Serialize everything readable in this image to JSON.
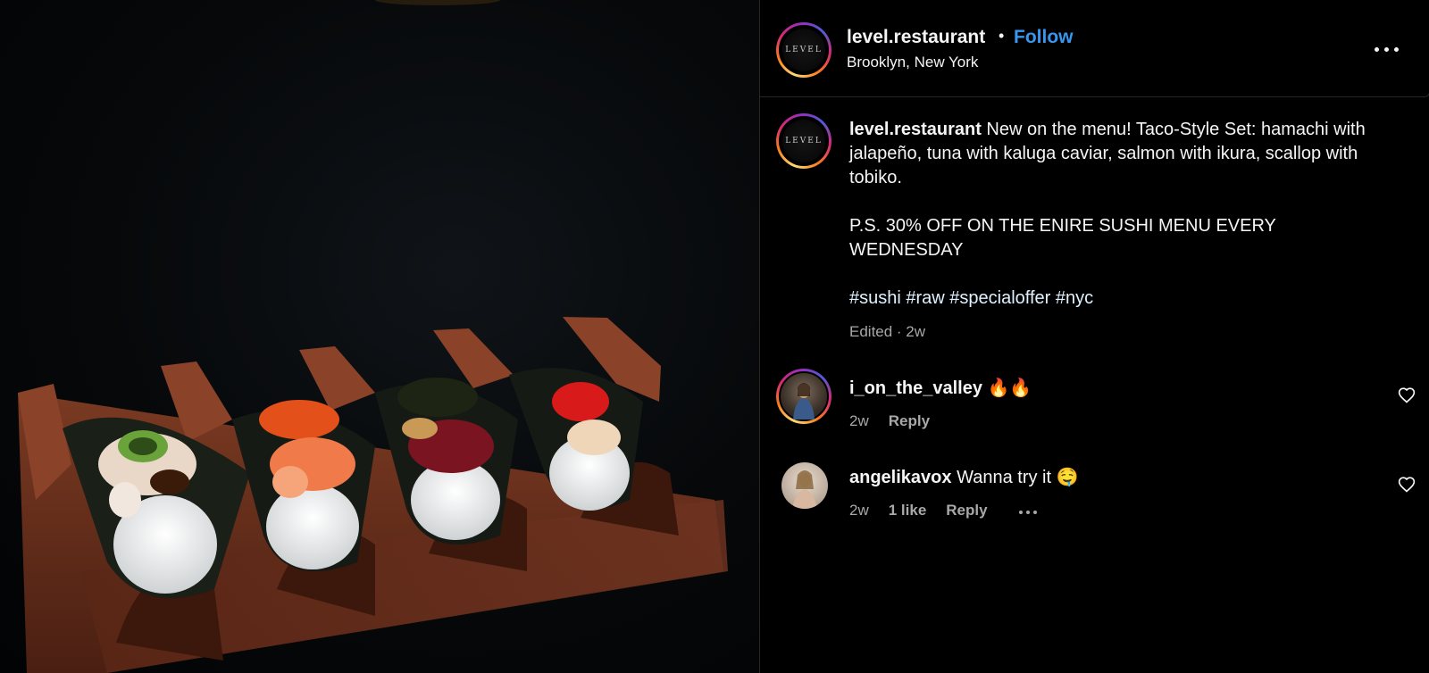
{
  "post": {
    "username": "level.restaurant",
    "follow_label": "Follow",
    "location": "Brooklyn, New York",
    "separator": "•"
  },
  "caption": {
    "username": "level.restaurant",
    "text": "New on the menu! Taco-Style Set: hamachi with jalapeño, tuna with kaluga caviar, salmon with ikura, scallop with tobiko.",
    "promo": "P.S. 30% OFF ON THE ENIRE SUSHI MENU EVERY WEDNESDAY",
    "hashtags": [
      "#sushi",
      "#raw",
      "#specialoffer",
      "#nyc"
    ],
    "meta": "Edited · 2w"
  },
  "comments": [
    {
      "username": "i_on_the_valley",
      "text": "🔥🔥",
      "time": "2w",
      "likes": "",
      "reply_label": "Reply"
    },
    {
      "username": "angelikavox",
      "text": "Wanna try it 🤤",
      "time": "2w",
      "likes": "1 like",
      "reply_label": "Reply"
    }
  ],
  "logo_text": "LEVEL",
  "icons": {
    "more": "more-options-icon",
    "heart": "heart-outline-icon"
  },
  "colors": {
    "follow": "#3797f0",
    "secondary_text": "#a8a8a8",
    "background": "#000000"
  }
}
